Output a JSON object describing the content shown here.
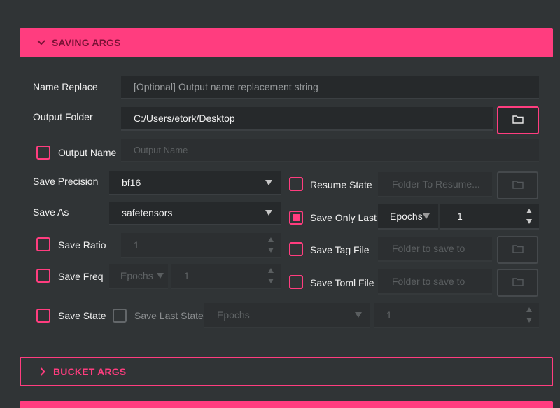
{
  "sections": {
    "saving": {
      "title": "SAVING ARGS"
    },
    "bucket": {
      "title": "BUCKET ARGS"
    }
  },
  "colors": {
    "accent": "#ff3d7f",
    "background": "#303436",
    "field": "#26292b"
  },
  "saving": {
    "name_replace": {
      "label": "Name Replace",
      "value": "",
      "placeholder": "[Optional] Output name replacement string"
    },
    "output_folder": {
      "label": "Output Folder",
      "value": "C:/Users/etork/Desktop",
      "button_icon": "folder-icon"
    },
    "output_name": {
      "label": "Output Name",
      "checked": false,
      "placeholder": "Output Name"
    },
    "save_precision": {
      "label": "Save Precision",
      "value": "bf16"
    },
    "save_as": {
      "label": "Save As",
      "value": "safetensors"
    },
    "save_ratio": {
      "label": "Save Ratio",
      "checked": false,
      "value": "1"
    },
    "save_freq": {
      "label": "Save Freq",
      "checked": false,
      "unit": "Epochs",
      "value": "1"
    },
    "save_state": {
      "label": "Save State",
      "checked": false
    },
    "save_last_state": {
      "label": "Save Last State",
      "checked": false,
      "unit": "Epochs",
      "value": "1"
    },
    "resume_state": {
      "label": "Resume State",
      "checked": false,
      "placeholder": "Folder To Resume..."
    },
    "save_only_last": {
      "label": "Save Only Last",
      "checked": true,
      "unit": "Epochs",
      "value": "1"
    },
    "save_tag_file": {
      "label": "Save Tag File",
      "checked": false,
      "placeholder": "Folder to save to"
    },
    "save_toml_file": {
      "label": "Save Toml File",
      "checked": false,
      "placeholder": "Folder to save to"
    }
  }
}
